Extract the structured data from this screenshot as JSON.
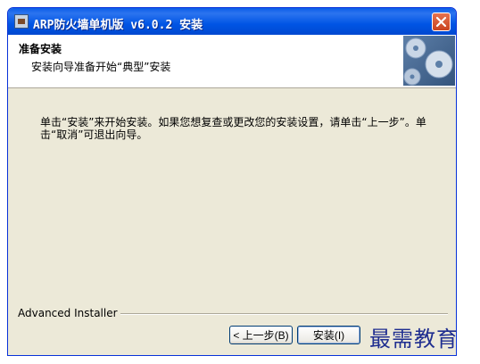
{
  "window": {
    "title": "ARP防火墙单机版 v6.0.2 安装"
  },
  "header": {
    "title": "准备安装",
    "subtitle": "安装向导准备开始“典型”安装"
  },
  "main": {
    "description": "单击“安装”来开始安装。如果您想复查或更改您的安装设置，请单击“上一步”。单击“取消”可退出向导。"
  },
  "footer": {
    "brand": "Advanced Installer",
    "back_label": "< 上一步(B)",
    "install_label": "安装(I)"
  },
  "watermark": "最需教育",
  "colors": {
    "titlebar": "#0055e5",
    "window_bg": "#ece9d8",
    "close_button": "#d9552f",
    "watermark": "#1f2e90"
  }
}
